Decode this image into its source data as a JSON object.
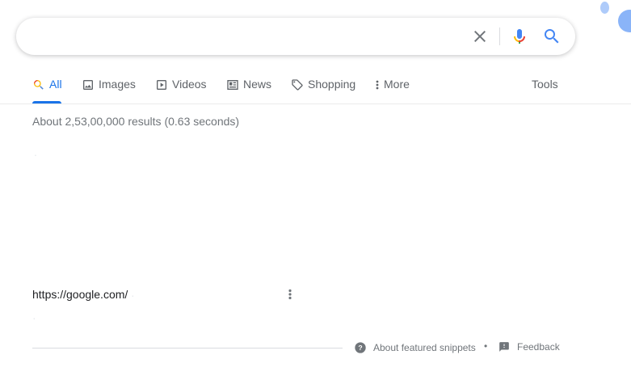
{
  "search": {
    "query": "",
    "placeholder": ""
  },
  "tabs": [
    {
      "label": "All",
      "icon": "search-icon",
      "active": true
    },
    {
      "label": "Images",
      "icon": "image-icon",
      "active": false
    },
    {
      "label": "Videos",
      "icon": "video-icon",
      "active": false
    },
    {
      "label": "News",
      "icon": "news-icon",
      "active": false
    },
    {
      "label": "Shopping",
      "icon": "tag-icon",
      "active": false
    },
    {
      "label": "More",
      "icon": "more-vert-icon",
      "active": false
    }
  ],
  "tools_label": "Tools",
  "result_stats": "About 2,53,00,000 results (0.63 seconds)",
  "result": {
    "url": "https://google.com/"
  },
  "footer": {
    "about_snippets": "About featured snippets",
    "separator": "•",
    "feedback": "Feedback"
  },
  "colors": {
    "accent": "#1a73e8",
    "text_secondary": "#70757a",
    "tab_text": "#5f6368",
    "mic_red": "#ea4335",
    "mic_blue": "#4285f4",
    "mic_yellow": "#fbbc04",
    "mic_green": "#34a853"
  }
}
